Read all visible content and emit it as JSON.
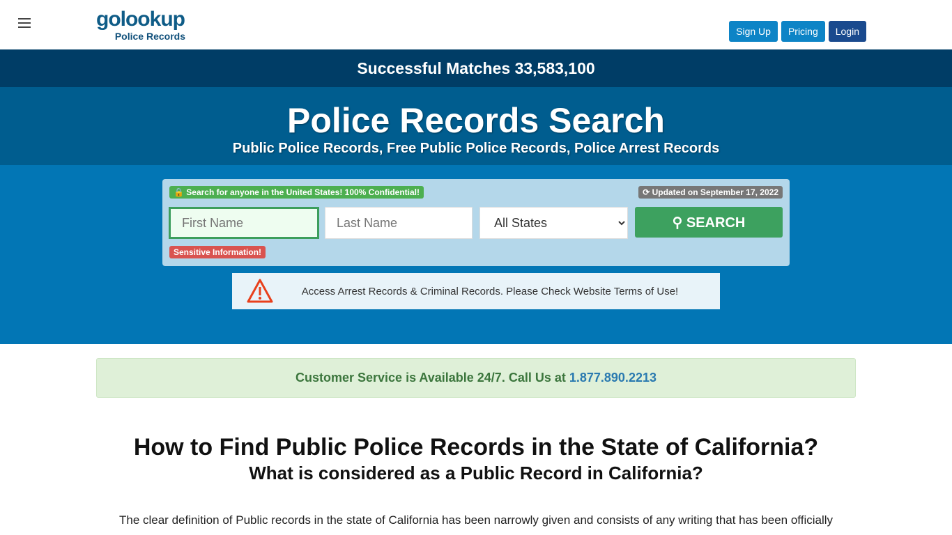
{
  "header": {
    "logo_main": "golookup",
    "logo_sub": "Police Records",
    "signup": "Sign Up",
    "pricing": "Pricing",
    "login": "Login"
  },
  "matches": "Successful Matches 33,583,100",
  "hero": {
    "title": "Police Records Search",
    "subtitle": "Public Police Records, Free Public Police Records, Police Arrest Records"
  },
  "search": {
    "confidential": "🔒 Search for anyone in the United States! 100% Confidential!",
    "updated": "⟳ Updated on September 17, 2022",
    "first_placeholder": "First Name",
    "last_placeholder": "Last Name",
    "state_selected": "All States",
    "button": "SEARCH",
    "sensitive": "Sensitive Information!"
  },
  "notice": "Access Arrest Records & Criminal Records. Please Check Website Terms of Use!",
  "customer_service": {
    "text": "Customer Service is Available 24/7. Call Us at ",
    "phone": "1.877.890.2213"
  },
  "article": {
    "title": "How to Find Public Police Records in the State of California?",
    "subtitle": "What is considered as a Public Record in California?",
    "para": "The clear definition of Public records in the state of California has been narrowly given and consists of any writing that has been officially"
  },
  "colors": {
    "matches_bg": "#003d66",
    "hero_bg": "#005d8f",
    "search_bg": "#0276b5",
    "search_btn": "#3da15f"
  }
}
